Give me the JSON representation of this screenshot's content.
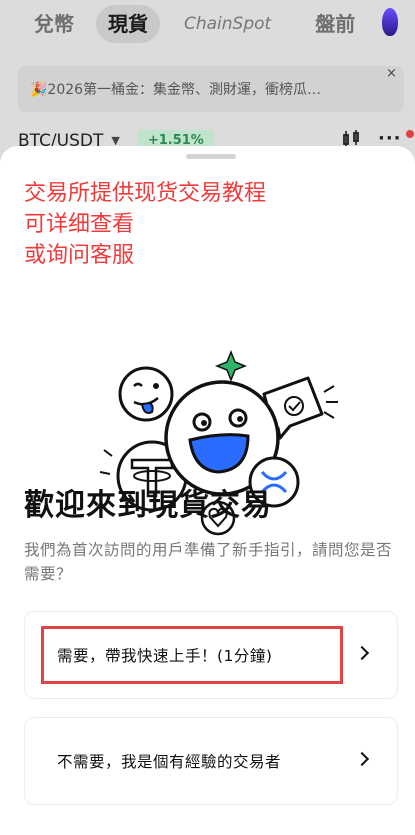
{
  "top_tabs": [
    "兌幣",
    "現貨",
    "ChainSpot",
    "盤前"
  ],
  "active_tab": "現貨",
  "banner": {
    "text": "🎉2026第一桶金：集金幣、測財運，衝榜瓜…",
    "close": "×"
  },
  "market": {
    "pair": "BTC/USDT",
    "caret": "▼",
    "change": "+1.51%",
    "more": "···"
  },
  "sheet": {
    "red_note": [
      "交易所提供现货交易教程",
      "可详细查看",
      "或询问客服"
    ],
    "title": "歡迎來到現貨交易",
    "subtitle": "我們為首次訪問的用戶準備了新手指引，請問您是否需要？",
    "options": [
      {
        "label": "需要，帶我快速上手！(1分鐘)"
      },
      {
        "label": "不需要，我是個有經驗的交易者"
      }
    ]
  },
  "colors": {
    "accent_red": "#ef3b3b",
    "highlight": "#e04545",
    "positive": "#2a8a4e",
    "face_blue": "#2a6cff"
  },
  "icons": [
    "flame-icon",
    "close-icon",
    "chart-icon",
    "more-icon",
    "chevron-right-icon",
    "tether-icon",
    "xrp-icon",
    "heart-icon",
    "sparkle-icon",
    "chat-bubble-icon"
  ]
}
